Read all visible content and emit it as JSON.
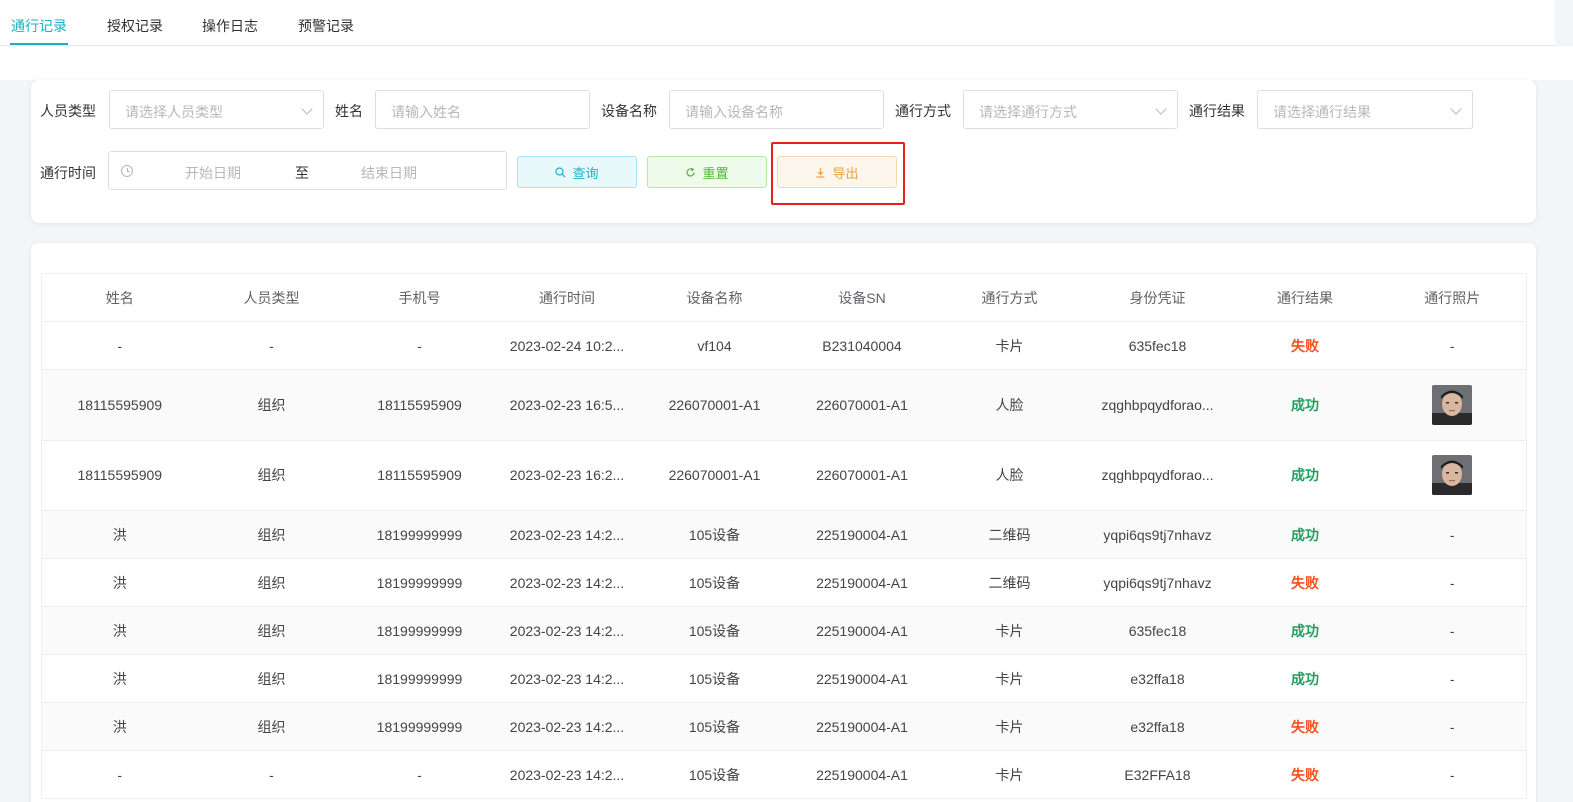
{
  "tabs": [
    {
      "label": "通行记录",
      "active": true
    },
    {
      "label": "授权记录",
      "active": false
    },
    {
      "label": "操作日志",
      "active": false
    },
    {
      "label": "预警记录",
      "active": false
    }
  ],
  "filters": {
    "person_type_label": "人员类型",
    "person_type_placeholder": "请选择人员类型",
    "name_label": "姓名",
    "name_placeholder": "请输入姓名",
    "device_label": "设备名称",
    "device_placeholder": "请输入设备名称",
    "pass_mode_label": "通行方式",
    "pass_mode_placeholder": "请选择通行方式",
    "pass_result_label": "通行结果",
    "pass_result_placeholder": "请选择通行结果",
    "pass_time_label": "通行时间",
    "start_date_placeholder": "开始日期",
    "date_separator": "至",
    "end_date_placeholder": "结束日期"
  },
  "buttons": {
    "query": "查询",
    "reset": "重置",
    "export": "导出"
  },
  "table": {
    "columns": [
      "姓名",
      "人员类型",
      "手机号",
      "通行时间",
      "设备名称",
      "设备SN",
      "通行方式",
      "身份凭证",
      "通行结果",
      "通行照片"
    ],
    "rows": [
      {
        "name": "-",
        "type": "-",
        "phone": "-",
        "time": "2023-02-24 10:2...",
        "device": "vf104",
        "sn": "B231040004",
        "mode": "卡片",
        "credential": "635fec18",
        "result": "失败",
        "photo": "-"
      },
      {
        "name": "18115595909",
        "type": "组织",
        "phone": "18115595909",
        "time": "2023-02-23 16:5...",
        "device": "226070001-A1",
        "sn": "226070001-A1",
        "mode": "人脸",
        "credential": "zqghbpqydforao...",
        "result": "成功",
        "photo": "face-photo"
      },
      {
        "name": "18115595909",
        "type": "组织",
        "phone": "18115595909",
        "time": "2023-02-23 16:2...",
        "device": "226070001-A1",
        "sn": "226070001-A1",
        "mode": "人脸",
        "credential": "zqghbpqydforao...",
        "result": "成功",
        "photo": "face-photo"
      },
      {
        "name": "洪",
        "type": "组织",
        "phone": "18199999999",
        "time": "2023-02-23 14:2...",
        "device": "105设备",
        "sn": "225190004-A1",
        "mode": "二维码",
        "credential": "yqpi6qs9tj7nhavz",
        "result": "成功",
        "photo": "-"
      },
      {
        "name": "洪",
        "type": "组织",
        "phone": "18199999999",
        "time": "2023-02-23 14:2...",
        "device": "105设备",
        "sn": "225190004-A1",
        "mode": "二维码",
        "credential": "yqpi6qs9tj7nhavz",
        "result": "失败",
        "photo": "-"
      },
      {
        "name": "洪",
        "type": "组织",
        "phone": "18199999999",
        "time": "2023-02-23 14:2...",
        "device": "105设备",
        "sn": "225190004-A1",
        "mode": "卡片",
        "credential": "635fec18",
        "result": "成功",
        "photo": "-"
      },
      {
        "name": "洪",
        "type": "组织",
        "phone": "18199999999",
        "time": "2023-02-23 14:2...",
        "device": "105设备",
        "sn": "225190004-A1",
        "mode": "卡片",
        "credential": "e32ffa18",
        "result": "成功",
        "photo": "-"
      },
      {
        "name": "洪",
        "type": "组织",
        "phone": "18199999999",
        "time": "2023-02-23 14:2...",
        "device": "105设备",
        "sn": "225190004-A1",
        "mode": "卡片",
        "credential": "e32ffa18",
        "result": "失败",
        "photo": "-"
      },
      {
        "name": "-",
        "type": "-",
        "phone": "-",
        "time": "2023-02-23 14:2...",
        "device": "105设备",
        "sn": "225190004-A1",
        "mode": "卡片",
        "credential": "E32FFA18",
        "result": "失败",
        "photo": "-"
      }
    ]
  },
  "colors": {
    "accent": "#1ab0c8",
    "success": "#20a05e",
    "fail": "#f4511e",
    "export_highlight": "#e5201b"
  }
}
